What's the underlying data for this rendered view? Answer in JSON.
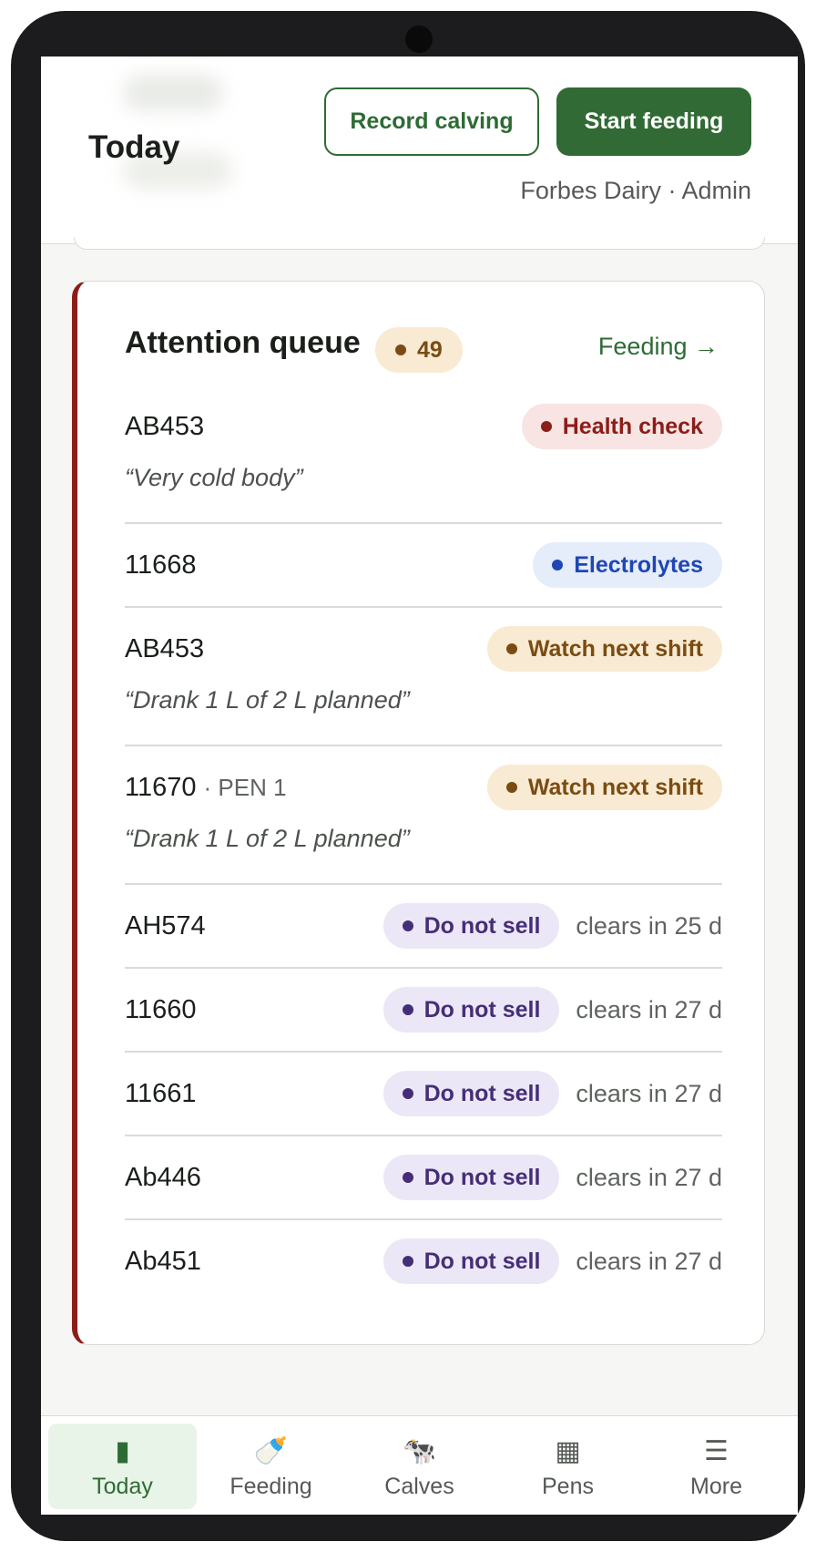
{
  "header": {
    "title": "Today",
    "record_calving_label": "Record calving",
    "start_feeding_label": "Start feeding",
    "org_role": "Forbes Dairy · Admin"
  },
  "attention_queue": {
    "title": "Attention queue",
    "count": "49",
    "link_label": "Feeding →",
    "items": [
      {
        "id": "AB453",
        "pen": "",
        "tag": "Health check",
        "clears": "",
        "note": "“Very cold body”"
      },
      {
        "id": "11668",
        "pen": "",
        "tag": "Electrolytes",
        "clears": "",
        "note": ""
      },
      {
        "id": "AB453",
        "pen": "",
        "tag": "Watch next shift",
        "clears": "",
        "note": "“Drank 1 L of 2 L planned”"
      },
      {
        "id": "11670",
        "pen": "· PEN 1",
        "tag": "Watch next shift",
        "clears": "",
        "note": "“Drank 1 L of 2 L planned”"
      },
      {
        "id": "AH574",
        "pen": "",
        "tag": "Do not sell",
        "clears": "clears in 25 d",
        "note": ""
      },
      {
        "id": "11660",
        "pen": "",
        "tag": "Do not sell",
        "clears": "clears in 27 d",
        "note": ""
      },
      {
        "id": "11661",
        "pen": "",
        "tag": "Do not sell",
        "clears": "clears in 27 d",
        "note": ""
      },
      {
        "id": "Ab446",
        "pen": "",
        "tag": "Do not sell",
        "clears": "clears in 27 d",
        "note": ""
      },
      {
        "id": "Ab451",
        "pen": "",
        "tag": "Do not sell",
        "clears": "clears in 27 d",
        "note": ""
      }
    ]
  },
  "nav": {
    "items": [
      {
        "label": "Today",
        "icon": "▮"
      },
      {
        "label": "Feeding",
        "icon": "🍼"
      },
      {
        "label": "Calves",
        "icon": "🐄"
      },
      {
        "label": "Pens",
        "icon": "▦"
      },
      {
        "label": "More",
        "icon": "☰"
      }
    ]
  },
  "colors": {
    "brand_green": "#316a35",
    "alert_red": "#8c1d18",
    "amber": "#7a4c12",
    "blue": "#1f46b4",
    "purple": "#452e78"
  }
}
